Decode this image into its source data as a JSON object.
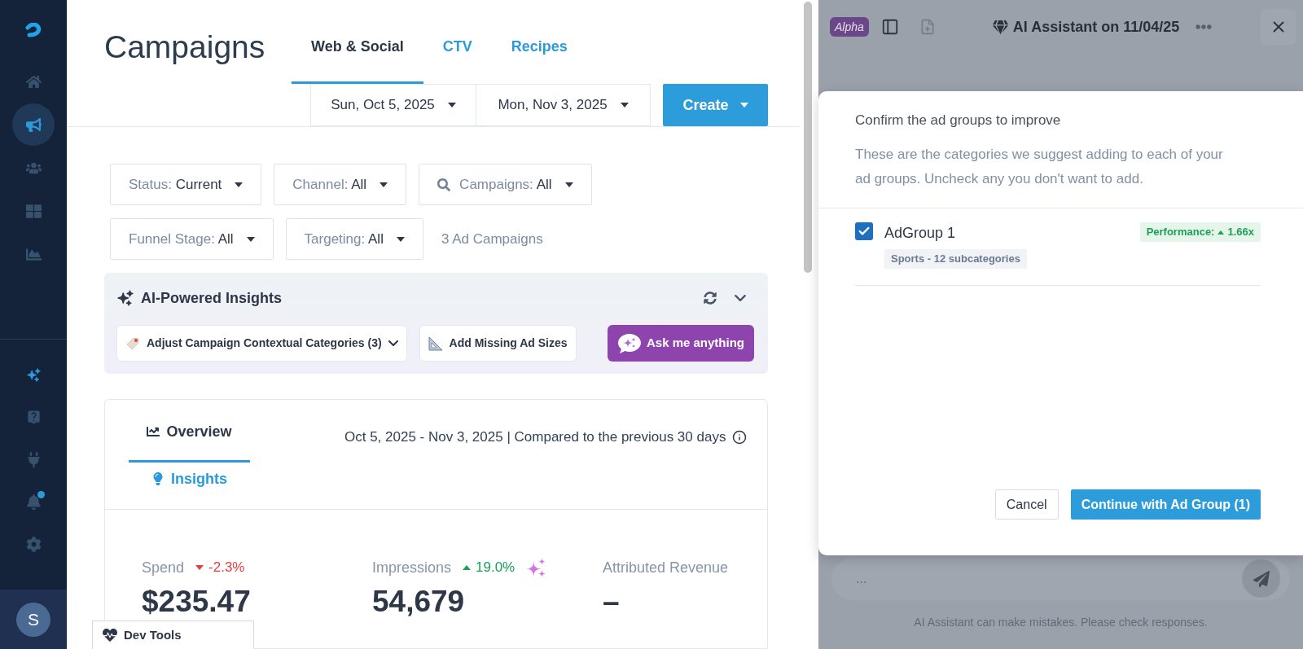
{
  "sidebar": {
    "top_items": [
      {
        "selected": false
      },
      {
        "selected": true
      },
      {
        "selected": false
      },
      {
        "selected": false
      },
      {
        "selected": false
      }
    ],
    "bottom_items": [
      {
        "active": true,
        "dot": false
      },
      {
        "active": false,
        "dot": false
      },
      {
        "active": false,
        "dot": false
      },
      {
        "active": false,
        "dot": true
      },
      {
        "active": false,
        "dot": false
      }
    ],
    "avatar": {
      "initial": "S"
    }
  },
  "header": {
    "title": "Campaigns",
    "tabs": [
      {
        "label": "Web & Social",
        "selected": true
      },
      {
        "label": "CTV",
        "selected": false
      },
      {
        "label": "Recipes",
        "selected": false
      }
    ],
    "start_date": "Sun, Oct 5, 2025",
    "end_date": "Mon, Nov 3, 2025",
    "create_button": "Create"
  },
  "filter_rows": [
    [
      {
        "kind": "select",
        "label": "Status:",
        "value": "Current"
      },
      {
        "kind": "select",
        "label": "Channel:",
        "value": "All"
      },
      {
        "kind": "search",
        "label": "Campaigns:",
        "value": "All"
      }
    ],
    [
      {
        "kind": "select",
        "label": "Funnel Stage:",
        "value": "All"
      },
      {
        "kind": "select",
        "label": "Targeting:",
        "value": "All"
      }
    ]
  ],
  "campaign_count": "3 Ad Campaigns",
  "ai_insights": {
    "title": "AI-Powered Insights",
    "chips": [
      {
        "kind": "dropdown",
        "label": "Adjust Campaign Contextual Categories (3)"
      },
      {
        "kind": "action",
        "label": "Add Missing Ad Sizes"
      }
    ],
    "ask_button": "Ask me anything"
  },
  "overview": {
    "tabs": [
      {
        "label": "Overview",
        "selected": true
      },
      {
        "label": "Insights",
        "selected": false
      }
    ],
    "period": "Oct 5, 2025 - Nov 3, 2025 | Compared to the previous 30 days",
    "metrics": [
      {
        "label": "Spend",
        "change": "-2.3%",
        "rising": false,
        "sparkle": false,
        "value": "$235.47"
      },
      {
        "label": "Impressions",
        "change": "19.0%",
        "rising": true,
        "sparkle": true,
        "value": "54,679"
      },
      {
        "label": "Attributed Revenue",
        "sparkle": false,
        "value": "–"
      }
    ]
  },
  "dev_tools": {
    "label": "Dev Tools"
  },
  "assistant": {
    "badge": "Alpha",
    "title": "AI Assistant on 11/04/25",
    "input": {
      "placeholder": "..."
    },
    "disclaimer": "AI Assistant can make mistakes. Please check responses."
  },
  "modal": {
    "title": "Confirm the ad groups to improve",
    "description": "These are the categories we suggest adding to each of your ad groups. Uncheck any you don't want to add.",
    "groups": [
      {
        "name": "AdGroup 1",
        "checked": true,
        "tag": "Sports - 12 subcategories",
        "performance_label": "Performance:",
        "performance_rising": true,
        "performance_value": "1.66x"
      }
    ],
    "cancel_button": "Cancel",
    "confirm_button": "Continue with Ad Group (1)"
  }
}
